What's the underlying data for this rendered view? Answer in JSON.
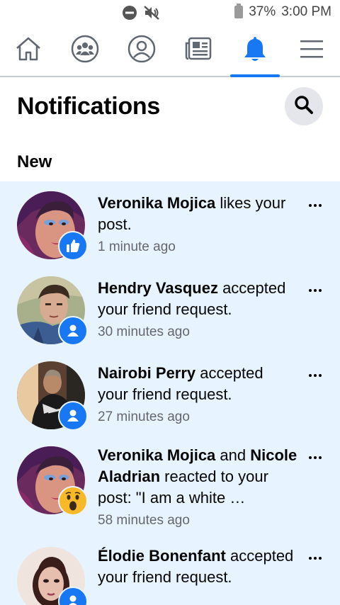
{
  "status_bar": {
    "battery": "37%",
    "time": "3:00 PM",
    "icons": [
      "do-not-disturb-icon",
      "mute-icon",
      "battery-icon"
    ]
  },
  "nav": {
    "tabs": [
      {
        "name": "home",
        "icon": "home-icon",
        "active": false
      },
      {
        "name": "groups",
        "icon": "groups-icon",
        "active": false
      },
      {
        "name": "profile",
        "icon": "profile-icon",
        "active": false
      },
      {
        "name": "news",
        "icon": "newspaper-icon",
        "active": false
      },
      {
        "name": "notifications",
        "icon": "bell-icon",
        "active": true
      },
      {
        "name": "menu",
        "icon": "menu-icon",
        "active": false
      }
    ]
  },
  "header": {
    "title": "Notifications",
    "search_icon": "search-icon"
  },
  "section": {
    "new_label": "New"
  },
  "notifications": [
    {
      "name": "Veronika Mojica",
      "text": " likes your post.",
      "time": "1 minute ago",
      "badge": "like-icon"
    },
    {
      "name": "Hendry Vasquez",
      "text": " accepted your friend request.",
      "time": "30 minutes ago",
      "badge": "friend-icon"
    },
    {
      "name": "Nairobi Perry",
      "text": " accepted your friend request.",
      "time": "27 minutes ago",
      "badge": "friend-icon"
    },
    {
      "name": "Veronika Mojica",
      "connector": " and ",
      "name2": "Nicole Aladrian",
      "text": " reacted to your post: \"I am a white …",
      "time": "58 minutes ago",
      "badge": "wow-icon"
    },
    {
      "name": "Élodie Bonenfant",
      "text": " accepted your friend request.",
      "time": "",
      "badge": "friend-icon"
    }
  ],
  "colors": {
    "accent": "#1877f2",
    "unread_bg": "#e7f3ff",
    "secondary_text": "#65676b"
  }
}
